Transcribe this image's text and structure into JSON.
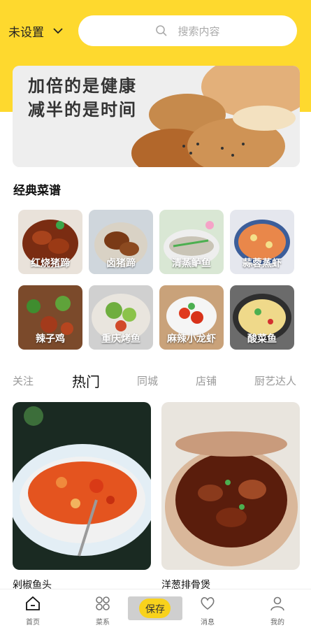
{
  "header": {
    "location_label": "未设置",
    "search_placeholder": "搜索内容"
  },
  "banner": {
    "line1": "加倍的是健康",
    "line2": "减半的是时间"
  },
  "recipes": {
    "title": "经典菜谱",
    "items": [
      {
        "label": "红烧猪蹄"
      },
      {
        "label": "卤猪蹄"
      },
      {
        "label": "清蒸鲈鱼"
      },
      {
        "label": "蒜蓉蒸虾"
      },
      {
        "label": "辣子鸡"
      },
      {
        "label": "重庆烤鱼"
      },
      {
        "label": "麻辣小龙虾"
      },
      {
        "label": "酸菜鱼"
      }
    ]
  },
  "tabs": [
    "关注",
    "热门",
    "同城",
    "店铺",
    "厨艺达人"
  ],
  "active_tab": "热门",
  "feed": [
    {
      "title": "剁椒鱼头"
    },
    {
      "title": "洋葱排骨煲"
    }
  ],
  "nav": {
    "home": "首页",
    "cuisine": "菜系",
    "message": "消息",
    "mine": "我的",
    "save": "保存"
  },
  "colors": {
    "accent": "#fed92e"
  }
}
